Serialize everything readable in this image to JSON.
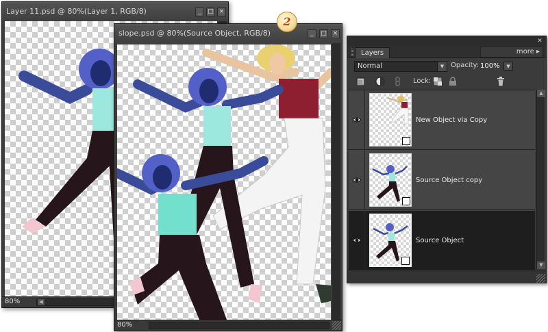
{
  "background_window": {
    "title": "Layer 11.psd @ 80%(Layer 1, RGB/8)",
    "zoom": "80%"
  },
  "front_window": {
    "title": "slope.psd @ 80%(Source Object, RGB/8)",
    "zoom": "80%"
  },
  "step_badge": "2",
  "layers_panel": {
    "tab_label": "Layers",
    "more_label": "more",
    "blend_mode": "Normal",
    "opacity_label": "Opacity:",
    "opacity_value": "100%",
    "lock_label": "Lock:",
    "layers": [
      {
        "name": "New  Object via Copy",
        "visible": true,
        "selected": false,
        "smart_object": true
      },
      {
        "name": "Source Object copy",
        "visible": true,
        "selected": false,
        "smart_object": true
      },
      {
        "name": "Source Object",
        "visible": true,
        "selected": true,
        "smart_object": true
      }
    ]
  },
  "icons": {
    "minimize": "minimize-icon",
    "maximize": "maximize-icon",
    "close": "close-icon",
    "visibility": "eye-icon",
    "smart_object": "smart-object-badge-icon",
    "trash": "trash-icon",
    "lock_transparency": "checker-lock-icon",
    "lock_all": "padlock-icon"
  },
  "colors": {
    "ui_dark": "#3d3d3d",
    "selected_row": "#1e1e1e",
    "badge_text": "#c24a0a"
  }
}
